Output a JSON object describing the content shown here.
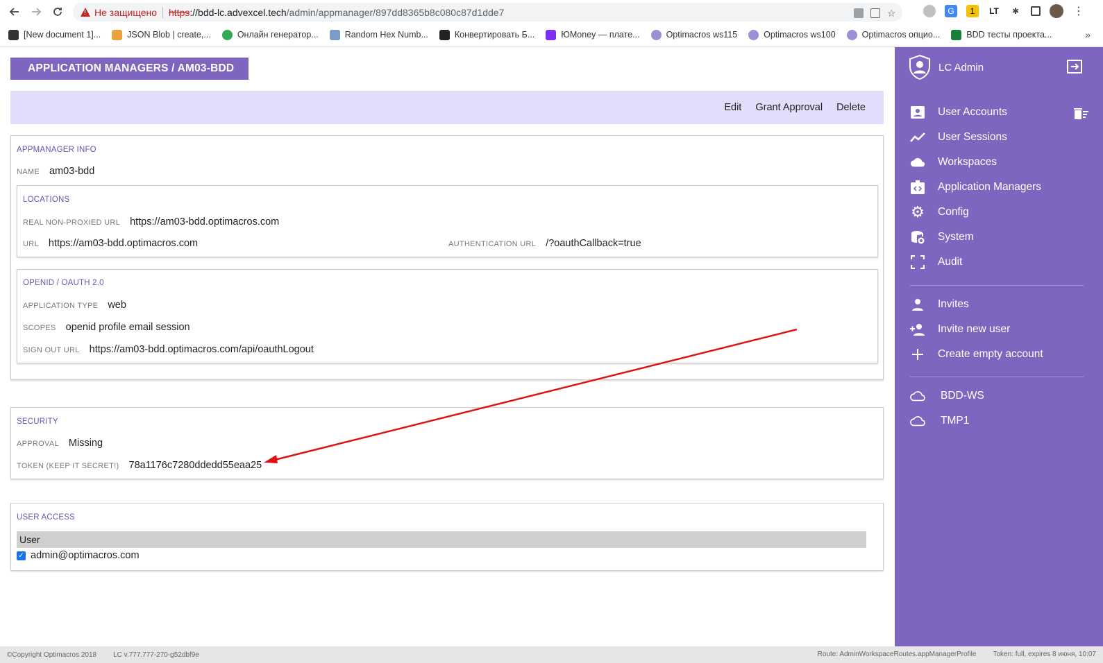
{
  "browser": {
    "warning": "Не защищено",
    "url_scheme": "https",
    "url_host": "://bdd-lc.advexcel.tech",
    "url_path": "/admin/appmanager/897dd8365b8c080c87d1dde7",
    "bookmarks": [
      {
        "label": "[New document 1]...",
        "icon": "braces-icon",
        "color": "#333"
      },
      {
        "label": "JSON Blob | create,...",
        "icon": "nerd-face-icon",
        "color": "#e8a33d"
      },
      {
        "label": "Онлайн генератор...",
        "icon": "green-circle-icon",
        "color": "#34a853"
      },
      {
        "label": "Random Hex Numb...",
        "icon": "snowflake-icon",
        "color": "#7a9cc6"
      },
      {
        "label": "Конвертировать Б...",
        "icon": "convert-icon",
        "color": "#222"
      },
      {
        "label": "ЮMoney — плате...",
        "icon": "yoomoney-icon",
        "color": "#7b2ff7"
      },
      {
        "label": "Optimacros ws115",
        "icon": "optimacros-icon",
        "color": "#9c8fd3"
      },
      {
        "label": "Optimacros ws100",
        "icon": "optimacros-icon",
        "color": "#9c8fd3"
      },
      {
        "label": "Optimacros опцио...",
        "icon": "optimacros-icon",
        "color": "#9c8fd3"
      },
      {
        "label": "BDD тесты проекта...",
        "icon": "sheets-icon",
        "color": "#188038"
      }
    ]
  },
  "page": {
    "title": "APPLICATION MANAGERS / AM03-BDD",
    "actions": {
      "edit": "Edit",
      "grant": "Grant Approval",
      "delete": "Delete"
    }
  },
  "appmanager_info": {
    "heading": "APPMANAGER INFO",
    "name_label": "NAME",
    "name_value": "am03-bdd"
  },
  "locations": {
    "heading": "LOCATIONS",
    "real_label": "REAL NON-PROXIED URL",
    "real_value": "https://am03-bdd.optimacros.com",
    "url_label": "URL",
    "url_value": "https://am03-bdd.optimacros.com",
    "auth_label": "AUTHENTICATION URL",
    "auth_value": "/?oauthCallback=true"
  },
  "openid": {
    "heading": "OPENID / OAUTH 2.0",
    "type_label": "APPLICATION TYPE",
    "type_value": "web",
    "scopes_label": "SCOPES",
    "scopes_value": "openid profile email session",
    "signout_label": "SIGN OUT URL",
    "signout_value": "https://am03-bdd.optimacros.com/api/oauthLogout"
  },
  "security": {
    "heading": "SECURITY",
    "approval_label": "APPROVAL",
    "approval_value": "Missing",
    "token_label": "TOKEN (KEEP IT SECRET!)",
    "token_value": "78a1176c7280ddedd55eaa25"
  },
  "user_access": {
    "heading": "USER ACCESS",
    "column": "User",
    "users": [
      {
        "email": "admin@optimacros.com",
        "checked": true
      }
    ]
  },
  "sidebar": {
    "user": "LC Admin",
    "items": [
      {
        "label": "User Accounts",
        "icon": "contact-card-icon"
      },
      {
        "label": "User Sessions",
        "icon": "trend-line-icon"
      },
      {
        "label": "Workspaces",
        "icon": "cloud-icon"
      },
      {
        "label": "Application Managers",
        "icon": "code-badge-icon"
      },
      {
        "label": "Config",
        "icon": "gear-icon"
      },
      {
        "label": "System",
        "icon": "database-icon"
      },
      {
        "label": "Audit",
        "icon": "fullscreen-corners-icon"
      }
    ],
    "invite_items": [
      {
        "label": "Invites",
        "icon": "person-icon"
      },
      {
        "label": "Invite new user",
        "icon": "person-add-icon"
      },
      {
        "label": "Create empty account",
        "icon": "plus-icon"
      }
    ],
    "workspaces": [
      {
        "label": "BDD-WS",
        "icon": "cloud-outline-icon"
      },
      {
        "label": "TMP1",
        "icon": "cloud-outline-icon"
      }
    ]
  },
  "footer": {
    "copyright": "©Copyright Optimacros 2018",
    "version": "LC v.777.777-270-g52dbf9e",
    "route": "Route: AdminWorkspaceRoutes.appManagerProfile",
    "token": "Token: full, expires 8 июня, 10:07"
  },
  "colors": {
    "accent": "#7e66c0",
    "action_bar": "#e0defa",
    "annotation_arrow": "#e01010"
  }
}
